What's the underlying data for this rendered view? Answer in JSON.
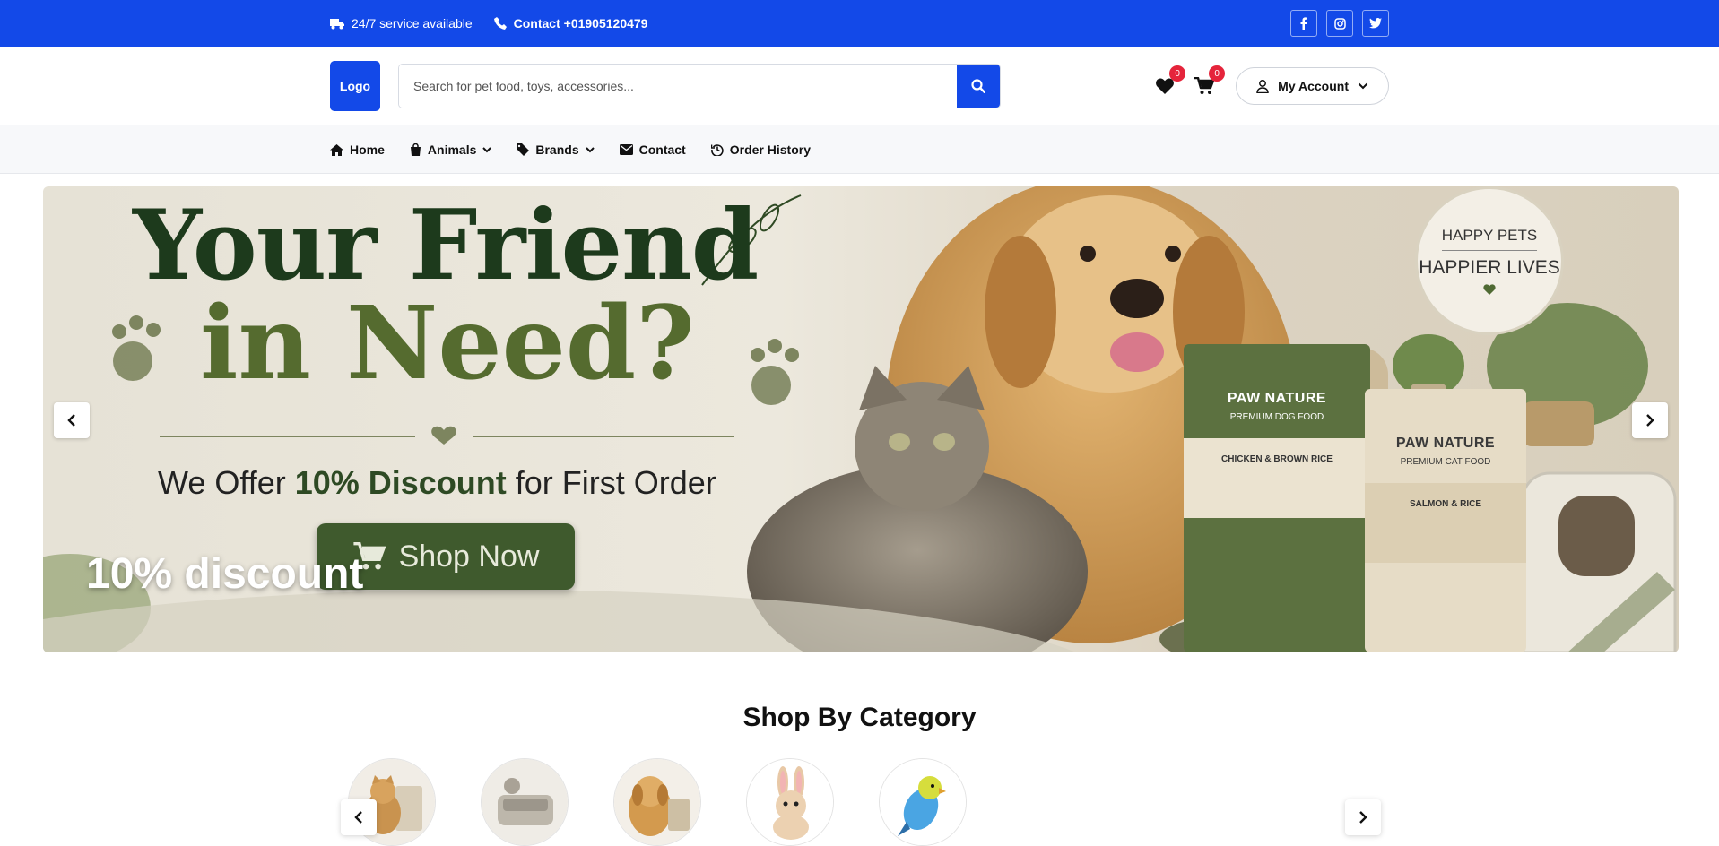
{
  "topbar": {
    "service_text": "24/7 service available",
    "contact_text": "Contact +01905120479",
    "socials": [
      "facebook-icon",
      "instagram-icon",
      "twitter-icon"
    ]
  },
  "header": {
    "logo_text": "Logo",
    "search_placeholder": "Search for pet food, toys, accessories...",
    "wishlist_count": "0",
    "cart_count": "0",
    "account_label": "My Account"
  },
  "nav": {
    "home": "Home",
    "animals": "Animals",
    "brands": "Brands",
    "contact": "Contact",
    "order_history": "Order History"
  },
  "hero": {
    "title_line1": "Your Friend",
    "title_line2": "in Need?",
    "subtitle_pre": "We Offer ",
    "subtitle_bold": "10% Discount",
    "subtitle_post": " for First Order",
    "cta": "Shop Now",
    "caption": "10% discount",
    "stamp_top": "HAPPY PETS",
    "stamp_bottom": "HAPPIER LIVES",
    "dog_bag": {
      "brand": "PAW NATURE",
      "type": "PREMIUM DOG FOOD",
      "flavor": "CHICKEN & BROWN RICE"
    },
    "cat_bag": {
      "brand": "PAW NATURE",
      "type": "PREMIUM CAT FOOD",
      "flavor": "SALMON & RICE"
    }
  },
  "categories": {
    "title": "Shop By Category",
    "items": [
      "cat-category-image",
      "litter-category-image",
      "dog-category-image",
      "rabbit-category-image",
      "bird-category-image"
    ]
  },
  "colors": {
    "brand_blue": "#1349e8",
    "badge_red": "#e5243b",
    "hero_green": "#3f5a2d"
  }
}
